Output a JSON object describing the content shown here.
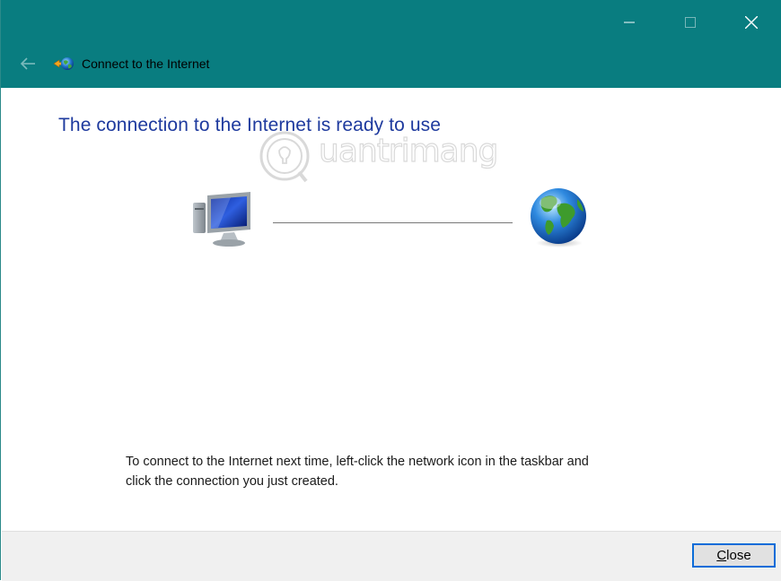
{
  "window": {
    "title": "Connect to the Internet",
    "titlebar_color": "#097d80",
    "controls": {
      "minimize_icon": "minimize-icon",
      "maximize_icon": "maximize-icon",
      "close_icon": "close-icon"
    },
    "back_icon": "back-arrow-icon"
  },
  "content": {
    "heading": "The connection to the Internet is ready to use",
    "heading_color": "#1e3a9e",
    "watermark_text": "uantrimang",
    "diagram": {
      "left_icon": "computer-icon",
      "right_icon": "globe-icon"
    },
    "instruction": "To connect to the Internet next time, left-click the network icon in the taskbar and click the connection you just created."
  },
  "footer": {
    "close_button_accesskey": "C",
    "close_button_rest": "lose"
  }
}
